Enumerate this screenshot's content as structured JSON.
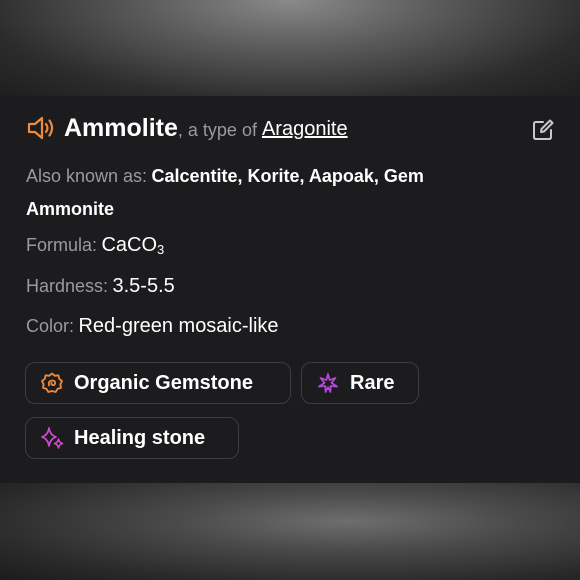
{
  "header": {
    "title": "Ammolite",
    "subtitle_prefix": ", a type of",
    "subtitle_link": "Aragonite",
    "speaker_icon": "speaker-icon",
    "edit_icon": "edit-icon"
  },
  "fields": {
    "aka_label": "Also known as:",
    "aka_value_line1": "Calcentite, Korite, Aapoak, Gem",
    "aka_value_line2": "Ammonite",
    "formula_label": "Formula:",
    "formula_value": "CaCO",
    "formula_subscript": "3",
    "hardness_label": "Hardness:",
    "hardness_value": "3.5-5.5",
    "color_label": "Color:",
    "color_value": "Red-green mosaic-like"
  },
  "tags": [
    {
      "label": "Organic Gemstone",
      "icon": "organic-gemstone-icon",
      "color": "#f08a3c"
    },
    {
      "label": "Rare",
      "icon": "rare-sparkle-icon",
      "color": "#b64ad8"
    },
    {
      "label": "Healing stone",
      "icon": "healing-sparkles-icon",
      "color": "#d24ad0"
    }
  ],
  "colors": {
    "accent_orange": "#f08a3c",
    "card_background": "#1c1c1e",
    "label_gray": "#9a9a9f"
  }
}
